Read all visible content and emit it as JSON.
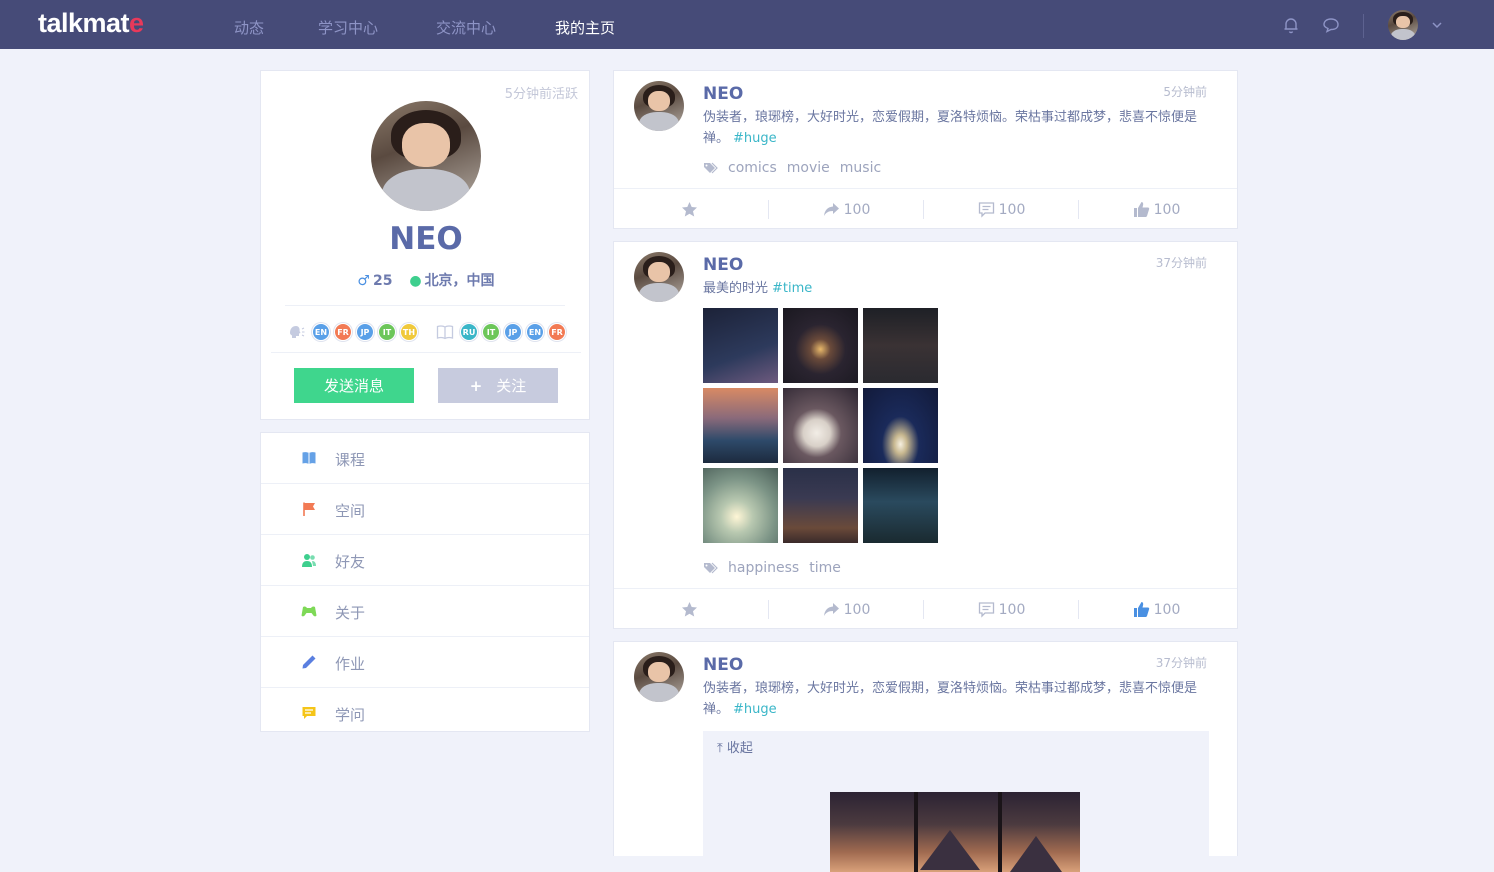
{
  "nav": {
    "logo_main": "talkmat",
    "logo_accent": "e",
    "links": [
      "动态",
      "学习中心",
      "交流中心",
      "我的主页"
    ],
    "active_index": 3,
    "icons": [
      "bell-icon",
      "chat-bubble-icon",
      "chevron-down-icon"
    ]
  },
  "profile": {
    "last_active": "5分钟前活跃",
    "name": "NEO",
    "age": "25",
    "location": "北京，中国",
    "speaks": [
      "EN",
      "FR",
      "JP",
      "IT",
      "TH"
    ],
    "learning": [
      "RU",
      "IT",
      "JP",
      "EN",
      "FR"
    ],
    "btn_message": "发送消息",
    "btn_follow": "关注"
  },
  "menu": {
    "items": [
      {
        "label": "课程",
        "icon": "book-icon",
        "color": "#4a90e2"
      },
      {
        "label": "空间",
        "icon": "flag-icon",
        "color": "#f27a54"
      },
      {
        "label": "好友",
        "icon": "users-icon",
        "color": "#3ecf8e"
      },
      {
        "label": "关于",
        "icon": "gamepad-icon",
        "color": "#7ed957"
      },
      {
        "label": "作业",
        "icon": "pencil-icon",
        "color": "#5a7fe0"
      },
      {
        "label": "学问",
        "icon": "comment-icon",
        "color": "#f5c518"
      }
    ]
  },
  "posts": [
    {
      "name": "NEO",
      "time": "5分钟前",
      "text": "伪装者，琅琊榜，大好时光，恋爱假期，夏洛特烦恼。荣枯事过都成梦，悲喜不惊便是禅。",
      "hashtag": "#huge",
      "tags": [
        "comics",
        "movie",
        "music"
      ],
      "share_count": "100",
      "comment_count": "100",
      "like_count": "100"
    },
    {
      "name": "NEO",
      "time": "37分钟前",
      "text": "最美的时光",
      "hashtag": "#time",
      "tags": [
        "happiness",
        "time"
      ],
      "share_count": "100",
      "comment_count": "100",
      "like_count": "100"
    },
    {
      "name": "NEO",
      "time": "37分钟前",
      "text": "伪装者，琅琊榜，大好时光，恋爱假期，夏洛特烦恼。荣枯事过都成梦，悲喜不惊便是禅。",
      "hashtag": "#huge",
      "collapse_label": "收起"
    }
  ],
  "colors": {
    "nav_bg": "#464b78",
    "accent_green": "#3fd68d",
    "name_blue": "#5a6aa8",
    "hashtag": "#3ab6c8",
    "like_active": "#4a90e2"
  }
}
